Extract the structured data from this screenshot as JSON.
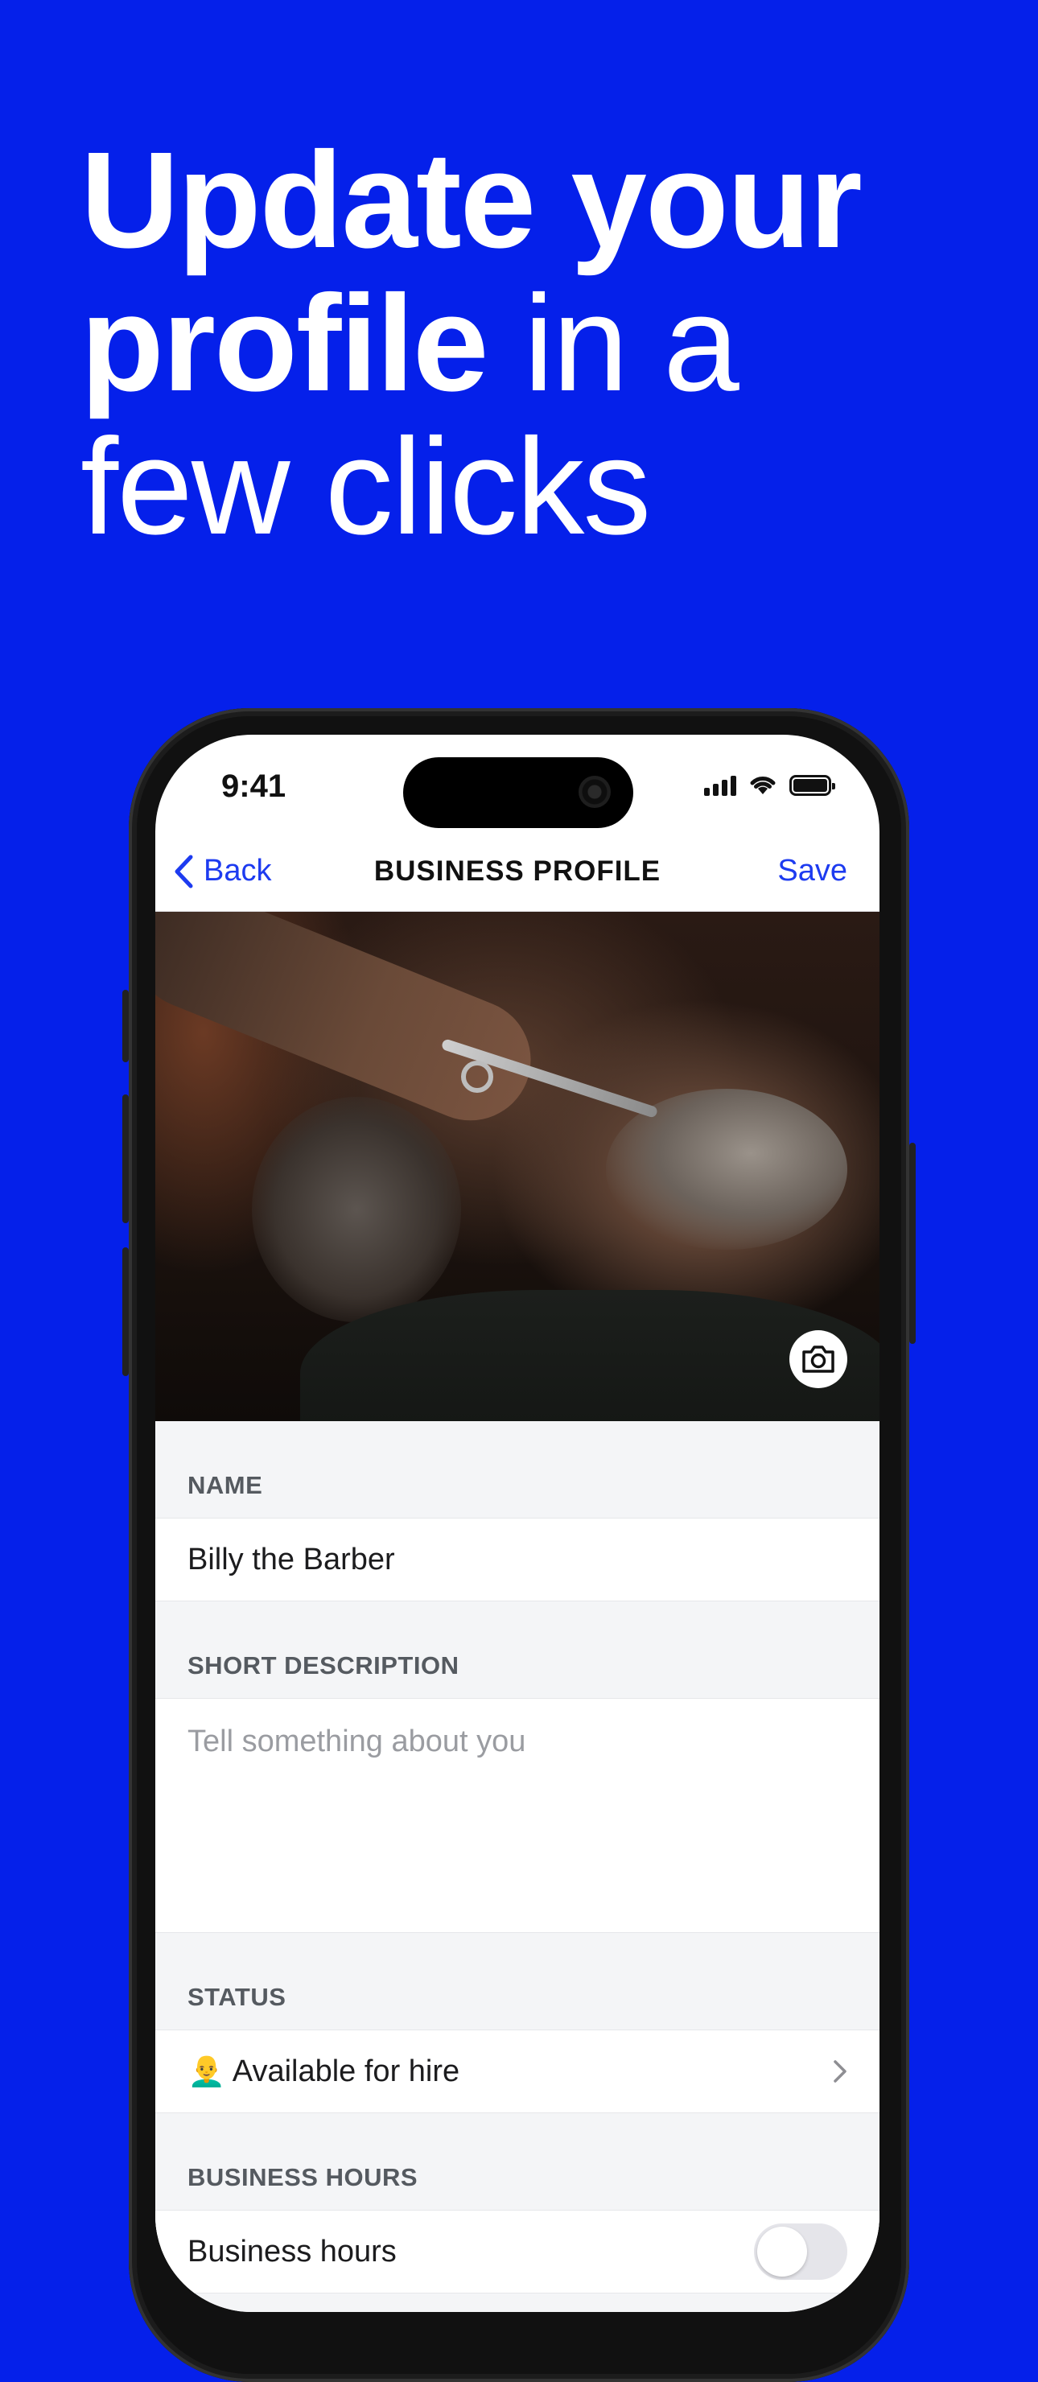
{
  "headline": {
    "line1_bold": "Update your",
    "line2_bold": "profile",
    "line2_light": " in a",
    "line3_light": "few clicks"
  },
  "status_bar": {
    "time": "9:41"
  },
  "navbar": {
    "back_label": "Back",
    "title": "BUSINESS PROFILE",
    "save_label": "Save"
  },
  "form": {
    "name": {
      "label": "NAME",
      "value": "Billy the Barber"
    },
    "description": {
      "label": "SHORT DESCRIPTION",
      "placeholder": "Tell something about you"
    },
    "status": {
      "label": "STATUS",
      "emoji": "👨‍🦲",
      "value": "Available for hire"
    },
    "business_hours": {
      "label": "BUSINESS HOURS",
      "row_label": "Business hours",
      "enabled": false
    }
  },
  "colors": {
    "background": "#0520ea",
    "accent": "#1d3bf0"
  },
  "icons": [
    "chevron-left-icon",
    "camera-icon",
    "chevron-right-icon",
    "signal-icon",
    "wifi-icon",
    "battery-icon"
  ]
}
